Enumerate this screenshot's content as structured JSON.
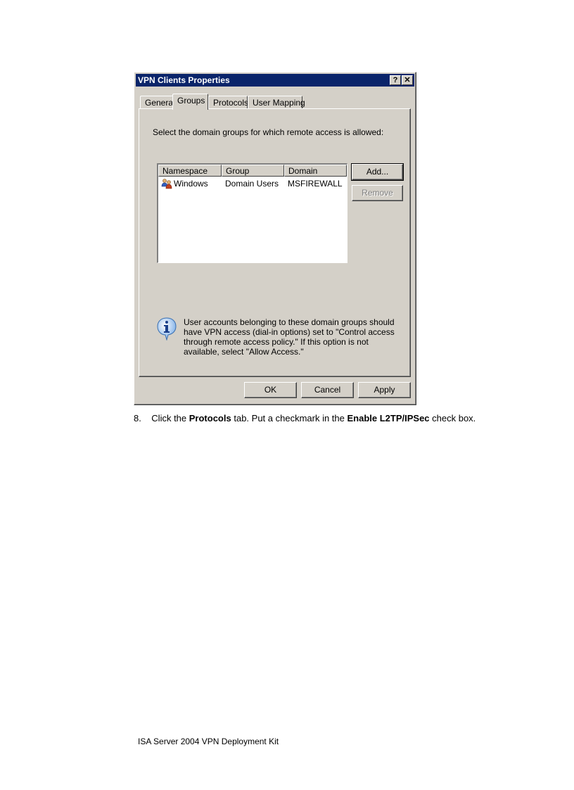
{
  "dialog": {
    "title": "VPN Clients Properties",
    "help_button": "?",
    "close_button": "✕",
    "tabs": [
      {
        "label": "General"
      },
      {
        "label": "Groups"
      },
      {
        "label": "Protocols"
      },
      {
        "label": "User Mapping"
      }
    ],
    "active_tab": "Groups",
    "instruction": "Select the domain groups for which remote access is allowed:",
    "list": {
      "columns": [
        "Namespace",
        "Group",
        "Domain"
      ],
      "rows": [
        {
          "namespace": "Windows",
          "group": "Domain Users",
          "domain": "MSFIREWALL",
          "icon": "user-group-icon"
        }
      ]
    },
    "add_button": "Add...",
    "remove_button": "Remove",
    "info_text": "User accounts belonging to these domain groups should have VPN access (dial-in options) set to \"Control access through remote access policy.\" If this option is not available, select \"Allow Access.\"",
    "ok_button": "OK",
    "cancel_button": "Cancel",
    "apply_button": "Apply"
  },
  "caption": {
    "number": "8.",
    "part1": "Click the ",
    "bold1": "Protocols",
    "part2": " tab. Put a checkmark in the ",
    "bold2": "Enable L2TP/IPSec",
    "part3": " check box."
  },
  "footer": "ISA Server 2004 VPN Deployment Kit"
}
